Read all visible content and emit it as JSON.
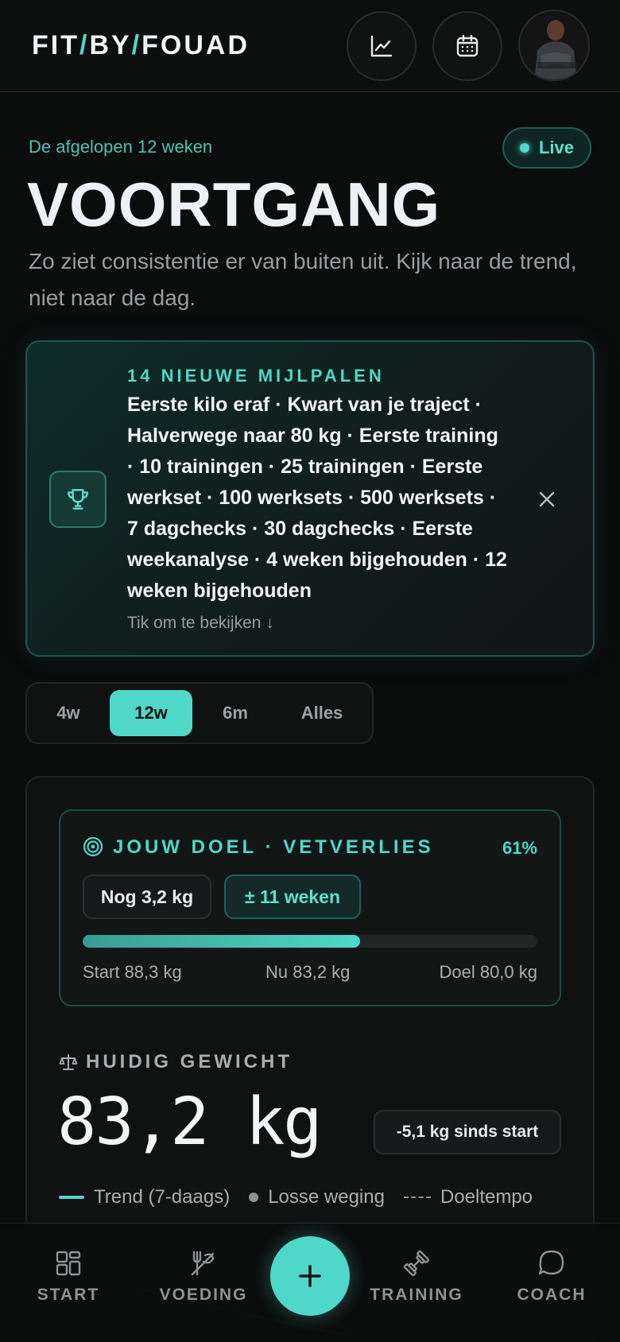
{
  "header": {
    "logo_part1": "FIT",
    "logo_slash": "/",
    "logo_part2": "BY",
    "logo_part3": "FOUAD",
    "icons": [
      "chart-icon",
      "calendar-icon",
      "avatar"
    ]
  },
  "intro": {
    "subtitle": "De afgelopen 12 weken",
    "live_label": "Live",
    "title": "VOORTGANG",
    "description": "Zo ziet consistentie er van buiten uit. Kijk naar de trend, niet naar de dag."
  },
  "milestones": {
    "heading": "14 NIEUWE MIJLPALEN",
    "list": "Eerste kilo eraf · Kwart van je traject · Halverwege naar 80 kg · Eerste training · 10 trainingen · 25 trainingen · Eerste werkset · 100 werksets · 500 werksets · 7 dagchecks · 30 dagchecks · Eerste weekanalyse · 4 weken bijgehouden · 12 weken bijgehouden",
    "tap_hint": "Tik om te bekijken ↓"
  },
  "range_tabs": [
    {
      "label": "4w",
      "active": false
    },
    {
      "label": "12w",
      "active": true
    },
    {
      "label": "6m",
      "active": false
    },
    {
      "label": "Alles",
      "active": false
    }
  ],
  "goal": {
    "title": "JOUW DOEL · VETVERLIES",
    "percent_label": "61%",
    "progress": 0.61,
    "remaining": "Nog 3,2 kg",
    "eta": "± 11 weken",
    "start_label": "Start 88,3 kg",
    "current_label": "Nu 83,2 kg",
    "target_label": "Doel 80,0 kg"
  },
  "weight": {
    "heading": "HUIDIG GEWICHT",
    "value": "83,2 kg",
    "delta": "-5,1 kg sinds start",
    "legend": {
      "trend": "Trend (7-daags)",
      "single": "Losse weging",
      "goal_pace": "Doeltempo"
    }
  },
  "nav": {
    "start": "START",
    "voeding": "VOEDING",
    "training": "TRAINING",
    "coach": "COACH"
  },
  "colors": {
    "accent": "#4fd8c8",
    "background": "#0b0c0c",
    "card": "#101212"
  }
}
